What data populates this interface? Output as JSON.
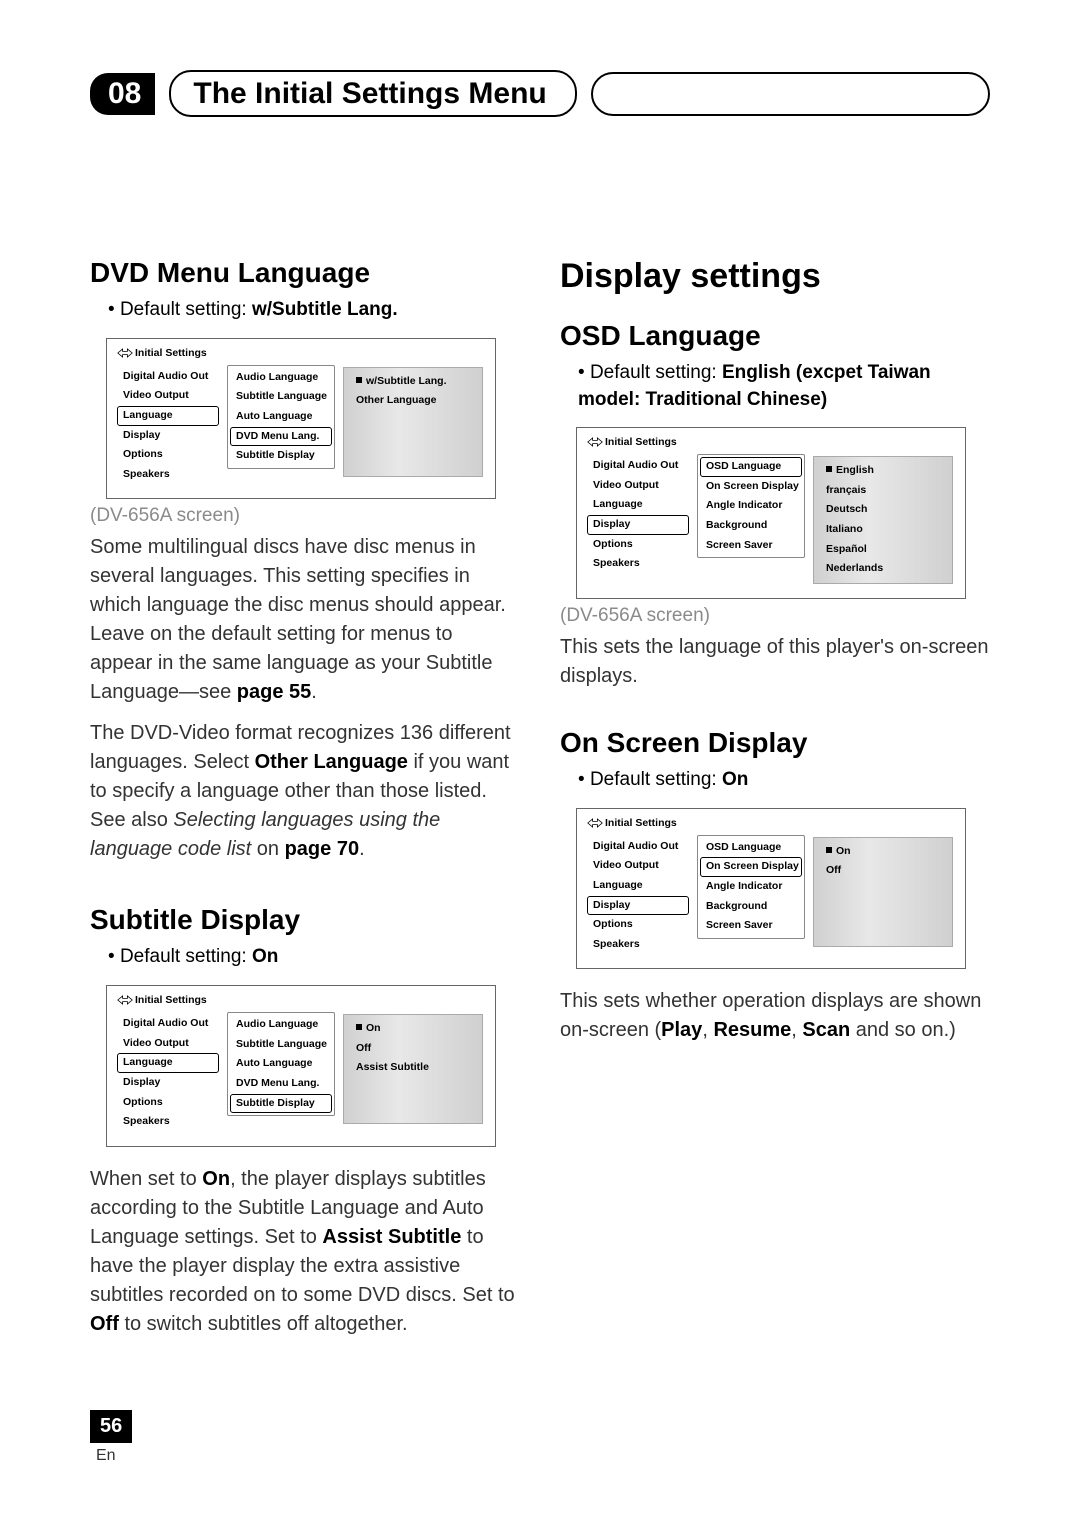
{
  "header": {
    "chapter_num": "08",
    "chapter_title": "The Initial Settings Menu"
  },
  "footer": {
    "page_num": "56",
    "lang": "En"
  },
  "left": {
    "dvd_menu": {
      "heading": "DVD Menu Language",
      "default_prefix": "Default setting: ",
      "default_value": "w/Subtitle Lang.",
      "caption": "(DV-656A screen)",
      "para1_a": "Some multilingual discs have disc menus in several languages. This setting specifies in which language the disc menus should appear. Leave on the default setting for menus to appear in the same language as your Subtitle Language—see ",
      "para1_b": "page 55",
      "para1_c": ".",
      "para2_a": "The DVD-Video format recognizes 136 different languages. Select ",
      "para2_b": "Other Language",
      "para2_c": " if you want to specify a language other than those listed. See also ",
      "para2_d": "Selecting languages using the language code list",
      "para2_e": " on ",
      "para2_f": "page 70",
      "para2_g": ".",
      "screenshot": {
        "title": "Initial Settings",
        "left_items": [
          "Digital Audio Out",
          "Video Output",
          "Language",
          "Display",
          "Options",
          "Speakers"
        ],
        "left_selected": "Language",
        "mid_items": [
          "Audio Language",
          "Subtitle Language",
          "Auto Language",
          "DVD Menu Lang.",
          "Subtitle Display"
        ],
        "mid_selected": "DVD Menu Lang.",
        "right_items": [
          "w/Subtitle Lang.",
          "Other Language"
        ],
        "right_marked": "w/Subtitle Lang."
      }
    },
    "subtitle": {
      "heading": "Subtitle Display",
      "default_prefix": "Default setting: ",
      "default_value": "On",
      "para_a": "When set to ",
      "para_b": "On",
      "para_c": ", the player displays subtitles according to the Subtitle Language and Auto Language settings. Set to ",
      "para_d": "Assist Subtitle",
      "para_e": " to have the player display the extra assistive subtitles recorded on to some DVD discs. Set to ",
      "para_f": "Off",
      "para_g": " to switch subtitles off altogether.",
      "screenshot": {
        "title": "Initial Settings",
        "left_items": [
          "Digital Audio Out",
          "Video Output",
          "Language",
          "Display",
          "Options",
          "Speakers"
        ],
        "left_selected": "Language",
        "mid_items": [
          "Audio Language",
          "Subtitle Language",
          "Auto Language",
          "DVD Menu Lang.",
          "Subtitle Display"
        ],
        "mid_selected": "Subtitle Display",
        "right_items": [
          "On",
          "Off",
          "Assist Subtitle"
        ],
        "right_marked": "On"
      }
    }
  },
  "right": {
    "section_heading": "Display settings",
    "osd": {
      "heading": "OSD Language",
      "default_prefix": "Default setting: ",
      "default_value": "English (excpet Taiwan model: Traditional Chinese)",
      "caption": "(DV-656A screen)",
      "para": "This sets the language of this player's on-screen displays.",
      "screenshot": {
        "title": "Initial Settings",
        "left_items": [
          "Digital Audio Out",
          "Video Output",
          "Language",
          "Display",
          "Options",
          "Speakers"
        ],
        "left_selected": "Display",
        "mid_items": [
          "OSD Language",
          "On Screen Display",
          "Angle Indicator",
          "Background",
          "Screen Saver"
        ],
        "mid_selected": "OSD Language",
        "right_items": [
          "English",
          "français",
          "Deutsch",
          "Italiano",
          "Español",
          "Nederlands"
        ],
        "right_marked": "English"
      }
    },
    "onscreen": {
      "heading": "On Screen Display",
      "default_prefix": "Default setting: ",
      "default_value": "On",
      "para_a": "This sets whether operation displays are shown on-screen (",
      "para_b": "Play",
      "para_c": ", ",
      "para_d": "Resume",
      "para_e": ", ",
      "para_f": "Scan",
      "para_g": " and so on.)",
      "screenshot": {
        "title": "Initial Settings",
        "left_items": [
          "Digital Audio Out",
          "Video Output",
          "Language",
          "Display",
          "Options",
          "Speakers"
        ],
        "left_selected": "Display",
        "mid_items": [
          "OSD Language",
          "On Screen Display",
          "Angle Indicator",
          "Background",
          "Screen Saver"
        ],
        "mid_selected": "On Screen Display",
        "right_items": [
          "On",
          "Off"
        ],
        "right_marked": "On"
      }
    }
  }
}
